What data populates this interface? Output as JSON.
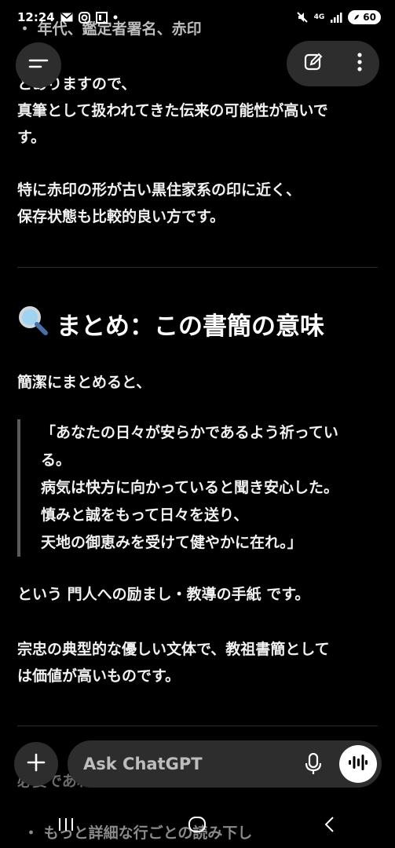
{
  "status_bar": {
    "time": "12:24",
    "network": "4G",
    "battery": "60",
    "left_icons": [
      "mail-icon",
      "instagram-icon",
      "gallery-icon",
      "dot-icon"
    ],
    "right_icons": [
      "mute-icon",
      "4g-icon",
      "signal-icon",
      "battery-icon"
    ]
  },
  "top_controls": {
    "left": "menu-icon",
    "right": [
      "edit-icon",
      "more-vertical-icon"
    ]
  },
  "content": {
    "faded_bullet": "・ 年代、鑑定者署名、赤印",
    "para1_lines": [
      "とありますので、",
      "真筆として扱われてきた伝来の可能性が高いで",
      "す。"
    ],
    "para2_lines": [
      "特に赤印の形が古い黒住家系の印に近く、",
      "保存状態も比較的良い方です。"
    ],
    "heading_icon": "magnifier-icon",
    "heading_text": "まとめ：この書簡の意味",
    "intro": "簡潔にまとめると、",
    "quote_lines": [
      "「あなたの日々が安らかであるよう祈ってい",
      "る。",
      "病気は快方に向かっていると聞き安心した。",
      "慎みと誠をもって日々を送り、",
      "天地の御恵みを受けて健やかに在れ。」"
    ],
    "summary": "という 門人への励まし・教導の手紙 です。",
    "closing_lines": [
      "宗忠の典型的な優しい文体で、教祖書簡として",
      "は価値が高いものです。"
    ],
    "behind_input_text": "必要であれば",
    "behind_nav_text": "・ もっと詳細な行ごとの読み下し"
  },
  "input": {
    "placeholder": "Ask ChatGPT",
    "add_icon": "plus-icon",
    "mic_icon": "mic-icon",
    "voice_icon": "voice-waveform-icon"
  },
  "nav": [
    "recent-apps-icon",
    "home-icon",
    "back-icon"
  ],
  "colors": {
    "background": "#000000",
    "surface": "#2d2d2d",
    "text": "#f2f2f2",
    "muted": "#bdbdbd"
  }
}
